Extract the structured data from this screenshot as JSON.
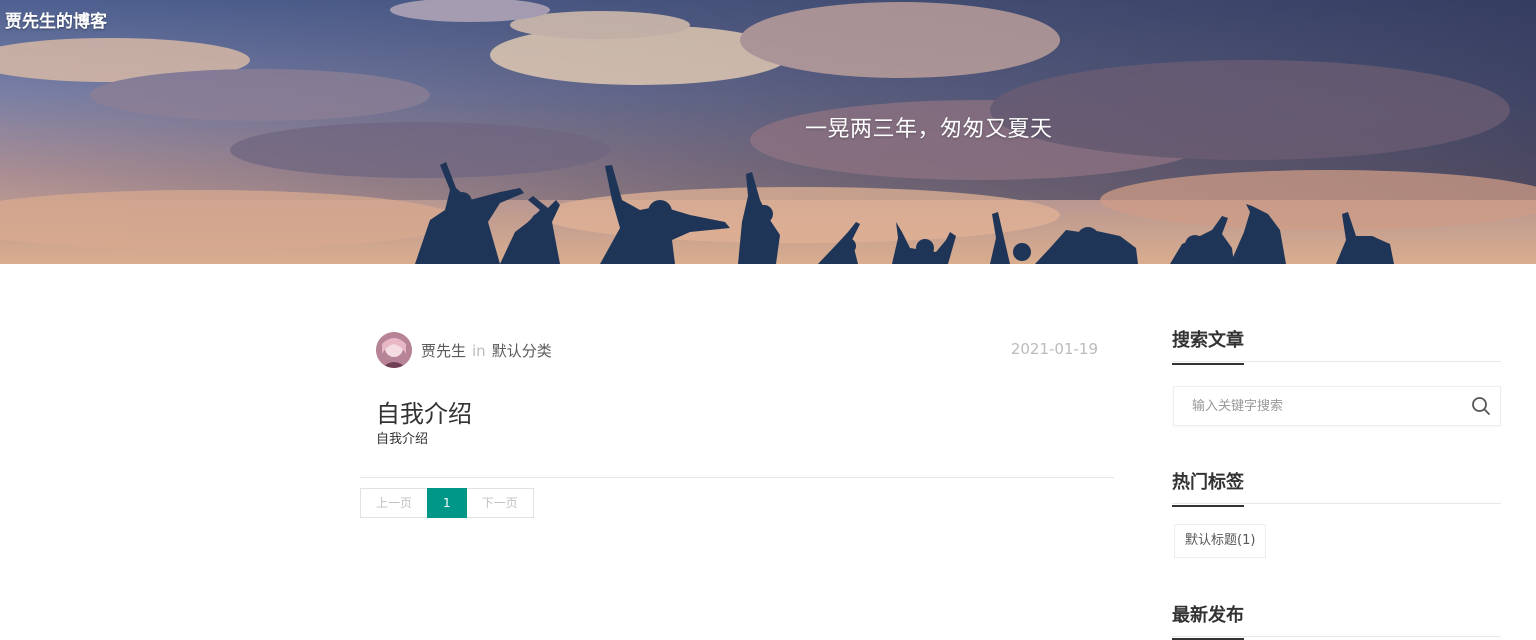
{
  "site": {
    "title": "贾先生的博客",
    "motto": "一晃两三年，匆匆又夏天"
  },
  "post": {
    "author": "贾先生",
    "in_word": "in",
    "category": "默认分类",
    "date": "2021-01-19",
    "title": "自我介绍",
    "excerpt": "自我介绍"
  },
  "pagination": {
    "prev_label": "上一页",
    "current_page": "1",
    "next_label": "下一页"
  },
  "sidebar": {
    "search": {
      "title": "搜索文章",
      "placeholder": "输入关键字搜索"
    },
    "tags": {
      "title": "热门标签",
      "items": [
        "默认标题(1)"
      ]
    },
    "latest": {
      "title": "最新发布"
    }
  },
  "colors": {
    "accent": "#009688",
    "silhouette": "#1f3558"
  },
  "icons": {
    "search": "search-icon",
    "avatar": "avatar"
  }
}
